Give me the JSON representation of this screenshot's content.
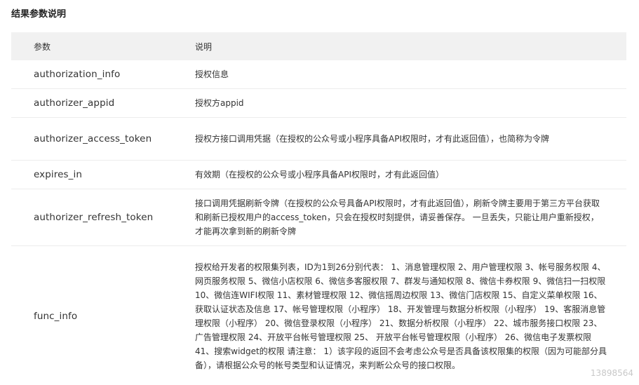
{
  "title": "结果参数说明",
  "table": {
    "headers": [
      "参数",
      "说明"
    ],
    "rows": [
      {
        "name": "authorization_info",
        "desc": "授权信息"
      },
      {
        "name": "authorizer_appid",
        "desc": "授权方appid"
      },
      {
        "name": "authorizer_access_token",
        "desc": "授权方接口调用凭据（在授权的公众号或小程序具备API权限时，才有此返回值），也简称为令牌"
      },
      {
        "name": "expires_in",
        "desc": "有效期（在授权的公众号或小程序具备API权限时，才有此返回值）"
      },
      {
        "name": "authorizer_refresh_token",
        "desc": "接口调用凭据刷新令牌（在授权的公众号具备API权限时，才有此返回值），刷新令牌主要用于第三方平台获取和刷新已授权用户的access_token，只会在授权时刻提供，请妥善保存。 一旦丢失，只能让用户重新授权，才能再次拿到新的刷新令牌"
      },
      {
        "name": "func_info",
        "desc": "授权给开发者的权限集列表，ID为1到26分别代表： 1、消息管理权限 2、用户管理权限 3、帐号服务权限 4、网页服务权限 5、微信小店权限 6、微信多客服权限 7、群发与通知权限 8、微信卡券权限 9、微信扫一扫权限 10、微信连WIFI权限 11、素材管理权限 12、微信摇周边权限 13、微信门店权限 15、自定义菜单权限 16、获取认证状态及信息 17、帐号管理权限（小程序） 18、开发管理与数据分析权限（小程序） 19、客服消息管理权限（小程序） 20、微信登录权限（小程序） 21、数据分析权限（小程序） 22、城市服务接口权限 23、广告管理权限 24、开放平台帐号管理权限 25、 开放平台帐号管理权限（小程序） 26、微信电子发票权限 41、搜索widget的权限 请注意： 1）该字段的返回不会考虑公众号是否具备该权限集的权限（因为可能部分具备），请根据公众号的帐号类型和认证情况，来判断公众号的接口权限。"
      }
    ]
  },
  "watermark": "13898564"
}
